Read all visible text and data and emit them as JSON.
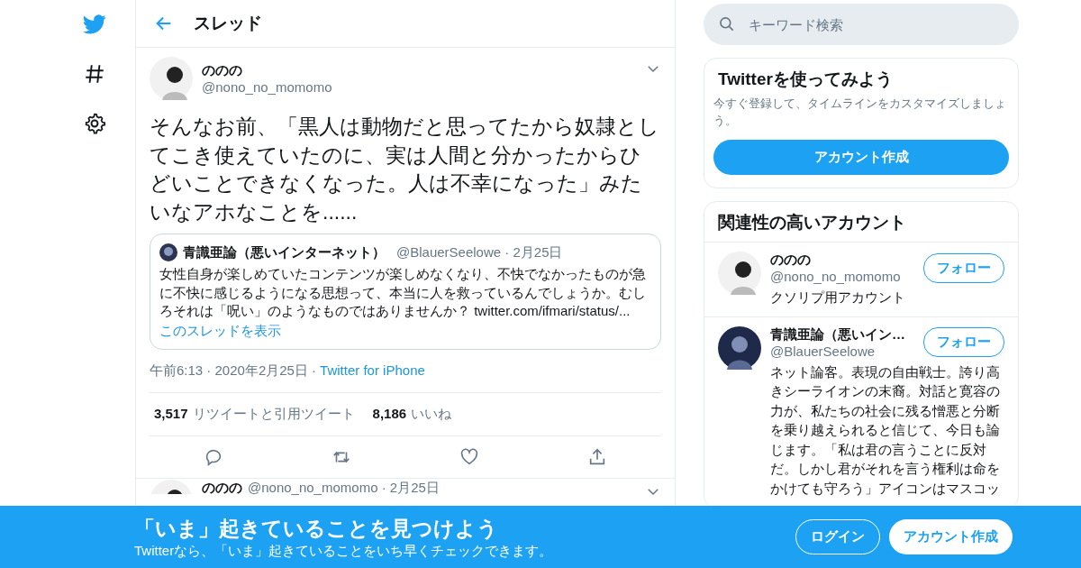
{
  "header": {
    "title": "スレッド"
  },
  "tweet": {
    "name": "ののの",
    "handle": "@nono_no_momomo",
    "text": "そんなお前、「黒人は動物だと思ってたから奴隷としてこき使えていたのに、実は人間と分かったからひどいことできなくなった。人は不幸になった」みたいなアホなことを......",
    "quote": {
      "name": "青識亜論（悪いインターネット）",
      "handle_date": "@BlauerSeelowe · 2月25日",
      "text": "女性自身が楽しめていたコンテンツが楽しめなくなり、不快でなかったものが急に不快に感じるようになる思想って、本当に人を救っているんでしょうか。むしろそれは「呪い」のようなものではありませんか？ twitter.com/ifmari/status/...",
      "link": "このスレッドを表示"
    },
    "timestamp": "午前6:13 · 2020年2月25日 ·",
    "source": "Twitter for iPhone",
    "stats": [
      {
        "count": "3,517",
        "label": "リツイートと引用ツイート"
      },
      {
        "count": "8,186",
        "label": "いいね"
      }
    ]
  },
  "reply": {
    "name": "ののの",
    "handle_date": "@nono_no_momomo · 2月25日"
  },
  "search": {
    "placeholder": "キーワード検索"
  },
  "signup_card": {
    "title": "Twitterを使ってみよう",
    "text": "今すぐ登録して、タイムラインをカスタマイズしましょう。",
    "button": "アカウント作成"
  },
  "related": {
    "title": "関連性の高いアカウント",
    "accounts": [
      {
        "name": "ののの",
        "handle": "@nono_no_momomo",
        "bio": "クソリプ用アカウント",
        "button": "フォロー"
      },
      {
        "name": "青識亜論（悪いイン…",
        "handle": "@BlauerSeelowe",
        "bio": "ネット論客。表現の自由戦士。誇り高きシーライオンの末裔。対話と寛容の力が、私たちの社会に残る憎悪と分断を乗り越えられると信じて、今日も論じます。「私は君の言うことに反対だ。しかし君がそれを言う権利は命をかけても守ろう」アイコンはマスコッ",
        "button": "フォロー"
      }
    ]
  },
  "banner": {
    "title": "「いま」起きていることを見つけよう",
    "text": "Twitterなら、「いま」起きていることをいち早くチェックできます。",
    "login": "ログイン",
    "signup": "アカウント作成"
  }
}
